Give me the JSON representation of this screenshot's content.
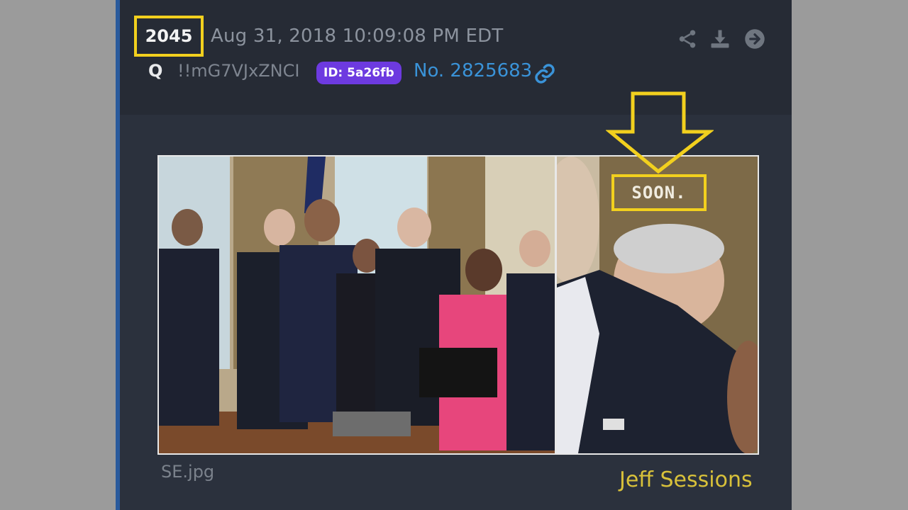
{
  "post": {
    "number": "2045",
    "date": "Aug 31, 2018 10:09:08 PM EDT",
    "author": "Q",
    "tripcode": "!!mG7VJxZNCI",
    "id_badge": "ID: 5a26fb",
    "post_no": "No. 2825683",
    "icons": {
      "link": "link-icon",
      "share": "share-icon",
      "download": "download-icon",
      "goto": "arrow-right-circle-icon"
    }
  },
  "image": {
    "overlay_text": "SOON.",
    "file_name": "SE.jpg",
    "caption": "Jeff Sessions"
  },
  "colors": {
    "highlight": "#f2d01e",
    "id_badge": "#6d3ae0",
    "post_no": "#3a93d8",
    "caption": "#d8c13a"
  }
}
